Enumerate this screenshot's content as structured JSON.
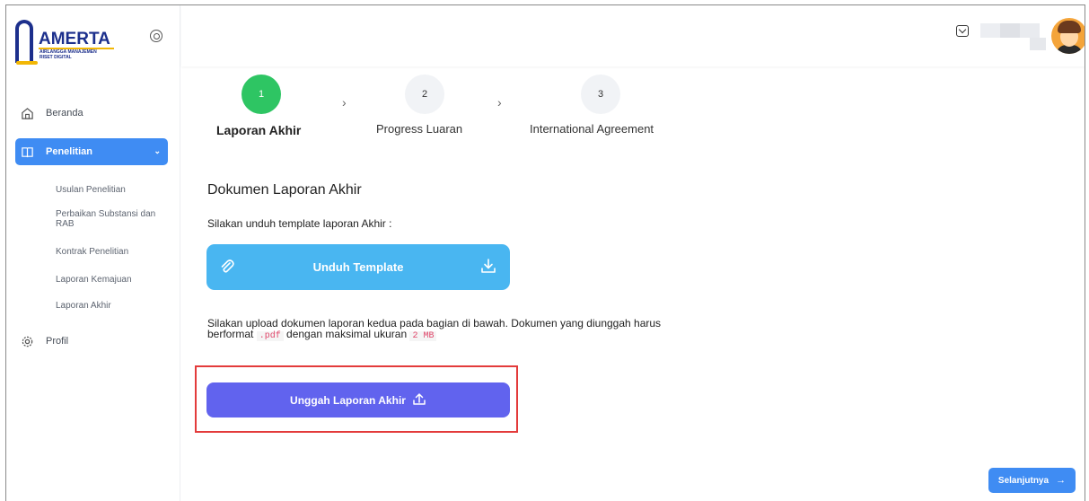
{
  "brand": {
    "name": "AMERTA",
    "subtitle_line1": "AIRLANGGA MANAJEMEN",
    "subtitle_line2": "RISET DIGITAL"
  },
  "sidebar": {
    "items": [
      {
        "label": "Beranda",
        "icon": "home-icon"
      },
      {
        "label": "Penelitian",
        "icon": "book-icon",
        "active": true
      },
      {
        "label": "Profil",
        "icon": "gear-icon"
      }
    ],
    "sub_items": [
      {
        "label": "Usulan Penelitian"
      },
      {
        "label": "Perbaikan Substansi dan RAB"
      },
      {
        "label": "Kontrak Penelitian"
      },
      {
        "label": "Laporan Kemajuan"
      },
      {
        "label": "Laporan Akhir"
      }
    ]
  },
  "stepper": {
    "steps": [
      {
        "number": "1",
        "label": "Laporan Akhir",
        "state": "active"
      },
      {
        "number": "2",
        "label": "Progress Luaran",
        "state": "pending"
      },
      {
        "number": "3",
        "label": "International Agreement",
        "state": "pending"
      }
    ]
  },
  "content": {
    "title": "Dokumen Laporan Akhir",
    "template_instruction": "Silakan unduh template laporan Akhir :",
    "download_button": "Unduh Template",
    "upload_note_part1": "Silakan upload dokumen laporan kedua pada bagian di bawah. Dokumen yang diunggah harus berformat ",
    "upload_format": ".pdf",
    "upload_note_part2": " dengan maksimal ukuran ",
    "upload_max_size": "2 MB",
    "upload_button": "Unggah Laporan Akhir"
  },
  "footer": {
    "next_button": "Selanjutnya"
  },
  "colors": {
    "primary": "#3f8cf3",
    "success": "#2ec563",
    "download": "#49b6f1",
    "upload": "#6163ee",
    "highlight": "#e33b3b"
  }
}
